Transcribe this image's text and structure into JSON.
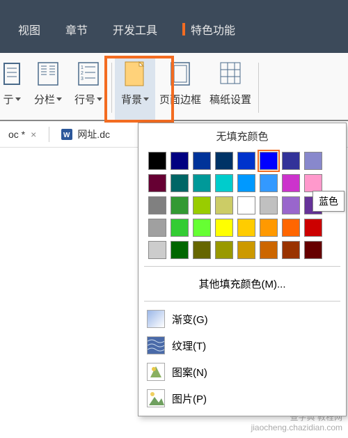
{
  "menubar": {
    "tabs": [
      "视图",
      "章节",
      "开发工具",
      "特色功能"
    ]
  },
  "ribbon": {
    "items": [
      {
        "label": "亍",
        "has_caret": true,
        "truncated": true
      },
      {
        "label": "分栏",
        "has_caret": true
      },
      {
        "label": "行号",
        "has_caret": true
      },
      {
        "label": "背景",
        "has_caret": true,
        "highlighted": true
      },
      {
        "label": "页面边框",
        "has_caret": false
      },
      {
        "label": "稿纸设置",
        "has_caret": false
      }
    ]
  },
  "tabs": {
    "doc1": {
      "name": "oc *",
      "close": "×"
    },
    "doc2": {
      "name": "网址.dc"
    }
  },
  "dropdown": {
    "no_fill": "无填充颜色",
    "colors": [
      [
        "#000000",
        "#000080",
        "#003399",
        "#003366",
        "#0033cc",
        "#0000ff",
        "#333399",
        "#8888cc"
      ],
      [
        "#660033",
        "#006666",
        "#009999",
        "#00cccc",
        "#0099ff",
        "#3399ff",
        "#cc33cc",
        "#ff99cc"
      ],
      [
        "#808080",
        "#339933",
        "#99cc00",
        "#cccc66",
        "#ffffff",
        "#c0c0c0",
        "#9966cc",
        "#663399"
      ],
      [
        "#a0a0a0",
        "#33cc33",
        "#66ff33",
        "#ffff00",
        "#ffcc00",
        "#ff9900",
        "#ff6600",
        "#cc0000"
      ],
      [
        "#cccccc",
        "#006600",
        "#666600",
        "#999900",
        "#cc9900",
        "#cc6600",
        "#993300",
        "#660000"
      ]
    ],
    "selected_color": {
      "row": 0,
      "col": 5
    },
    "tooltip": "蓝色",
    "more_colors": "其他填充颜色(M)...",
    "options": [
      {
        "label": "渐变(G)",
        "icon": "gradient"
      },
      {
        "label": "纹理(T)",
        "icon": "texture"
      },
      {
        "label": "图案(N)",
        "icon": "pattern"
      },
      {
        "label": "图片(P)",
        "icon": "picture"
      }
    ]
  },
  "watermark": {
    "line1": "查字典 教程网",
    "line2": "jiaocheng.chazidian.com"
  }
}
